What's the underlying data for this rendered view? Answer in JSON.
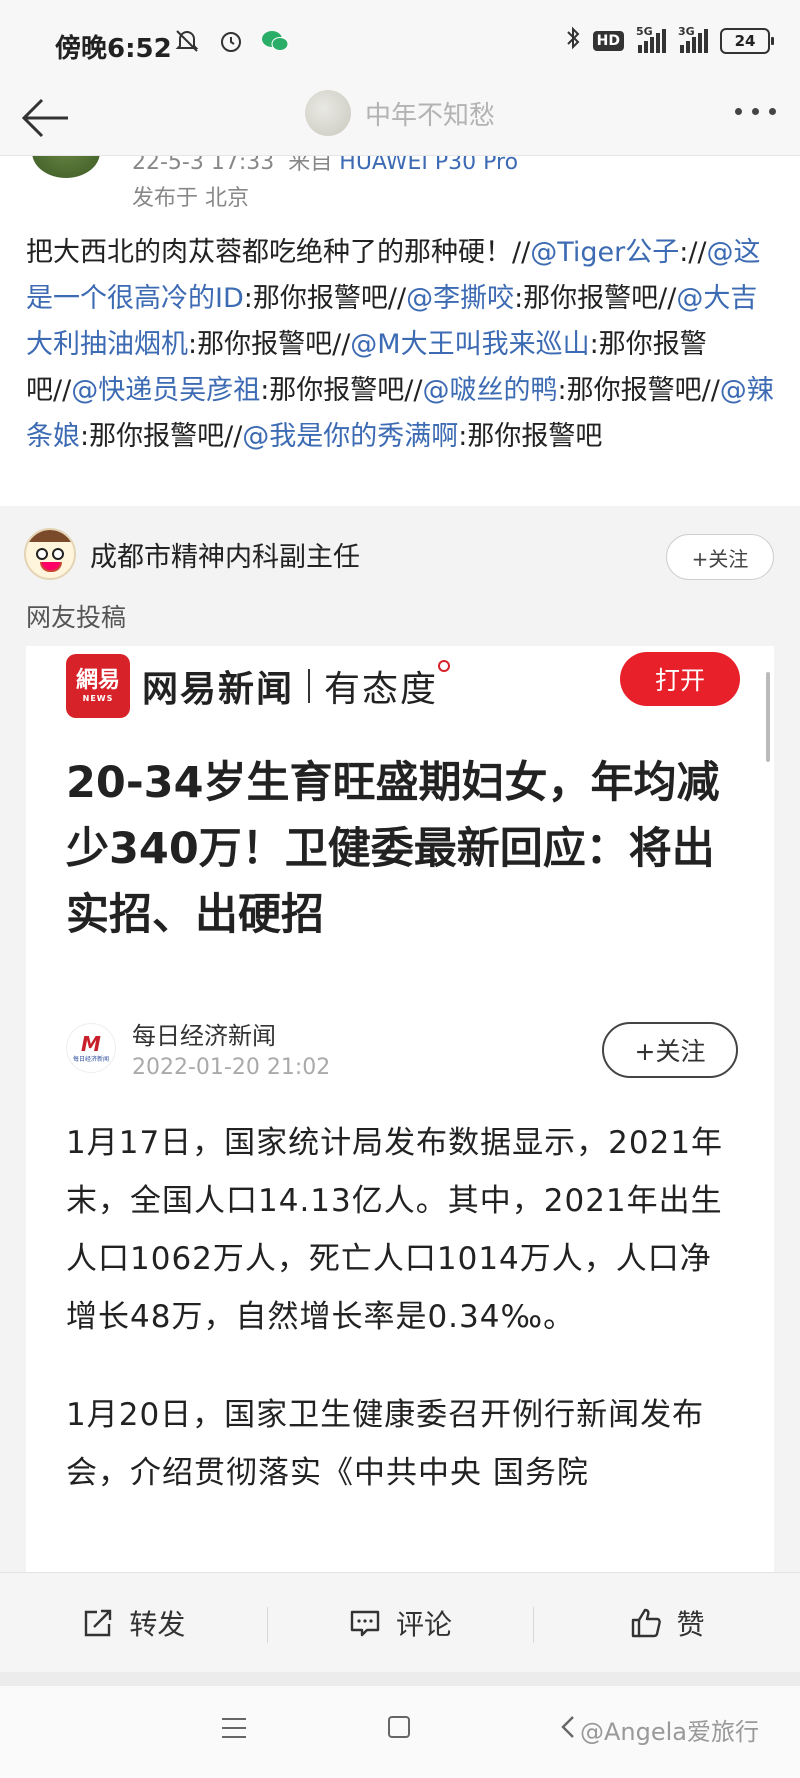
{
  "status_bar": {
    "time": "傍晚6:52",
    "network_hd": "HD",
    "sig1_label": "5G",
    "sig2_label": "3G",
    "battery": "24",
    "icons": [
      "mute-bell-icon",
      "alarm-icon",
      "wechat-icon",
      "bluetooth-icon"
    ]
  },
  "nav": {
    "title": "中年不知愁"
  },
  "post": {
    "meta_time": "22-5-3 17:33",
    "meta_from": "来自",
    "meta_device": "HUAWEI P30 Pro",
    "location": "发布于 北京",
    "body": [
      {
        "t": "text",
        "v": "把大西北的肉苁蓉都吃绝种了的那种硬！//"
      },
      {
        "t": "mention",
        "v": "@Tiger公子"
      },
      {
        "t": "text",
        "v": "://"
      },
      {
        "t": "mention",
        "v": "@这是一个很高冷的ID"
      },
      {
        "t": "text",
        "v": ":那你报警吧//"
      },
      {
        "t": "mention",
        "v": "@李撕咬"
      },
      {
        "t": "text",
        "v": ":那你报警吧//"
      },
      {
        "t": "mention",
        "v": "@大吉大利抽油烟机"
      },
      {
        "t": "text",
        "v": ":那你报警吧//"
      },
      {
        "t": "mention",
        "v": "@M大王叫我来巡山"
      },
      {
        "t": "text",
        "v": ":那你报警吧//"
      },
      {
        "t": "mention",
        "v": "@快递员吴彦祖"
      },
      {
        "t": "text",
        "v": ":那你报警吧//"
      },
      {
        "t": "mention",
        "v": "@啵丝的鸭"
      },
      {
        "t": "text",
        "v": ":那你报警吧//"
      },
      {
        "t": "mention",
        "v": "@辣条娘"
      },
      {
        "t": "text",
        "v": ":那你报警吧//"
      },
      {
        "t": "mention",
        "v": "@我是你的秀满啊"
      },
      {
        "t": "text",
        "v": ":那你报警吧"
      }
    ]
  },
  "repost": {
    "author": "成都市精神内科副主任",
    "follow_label": "+关注",
    "source_label": "网友投稿"
  },
  "article": {
    "logo_main": "網易",
    "logo_sub": "NEWS",
    "brand": "网易新闻",
    "slogan": "有态度",
    "open_label": "打开",
    "title": "20-34岁生育旺盛期妇女，年均减少340万！卫健委最新回应：将出实招、出硬招",
    "publisher_logo": "M",
    "publisher_logo_sub": "每日经济新闻",
    "publisher": "每日经济新闻",
    "publish_time": "2022-01-20 21:02",
    "follow_label": "+关注",
    "para1": "1月17日，国家统计局发布数据显示，2021年末，全国人口14.13亿人。其中，2021年出生人口1062万人，死亡人口1014万人，人口净增长48万，自然增长率是0.34‰。",
    "para2": "1月20日，国家卫生健康委召开例行新闻发布会，介绍贯彻落实《中共中央 国务院"
  },
  "actions": {
    "repost": "转发",
    "comment": "评论",
    "like": "赞"
  },
  "watermark": "@Angela爱旅行",
  "colors": {
    "mention": "#3d6bb3",
    "open_button": "#e8202a",
    "brand_red": "#d8222a"
  }
}
